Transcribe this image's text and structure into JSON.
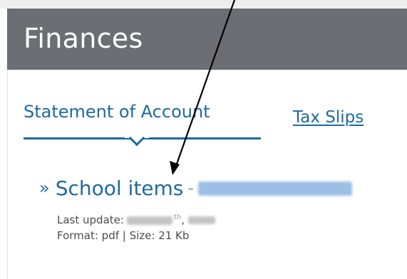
{
  "header": {
    "title": "Finances"
  },
  "tabs": {
    "active_label": "Statement of Account",
    "inactive_label": "Tax Slips"
  },
  "document": {
    "bullet": "»",
    "title": "School items",
    "separator": "-",
    "update_label": "Last update:",
    "date_suffix": "th",
    "date_comma": ",",
    "format_line": "Format: pdf | Size: 21 Kb"
  },
  "colors": {
    "header_bg": "#6b6f73",
    "accent": "#1d6aa0",
    "meta_text": "#4d4d4d"
  },
  "icons": {
    "tab_indicator": "caret-down-icon",
    "annotation": "arrow-annotation"
  }
}
